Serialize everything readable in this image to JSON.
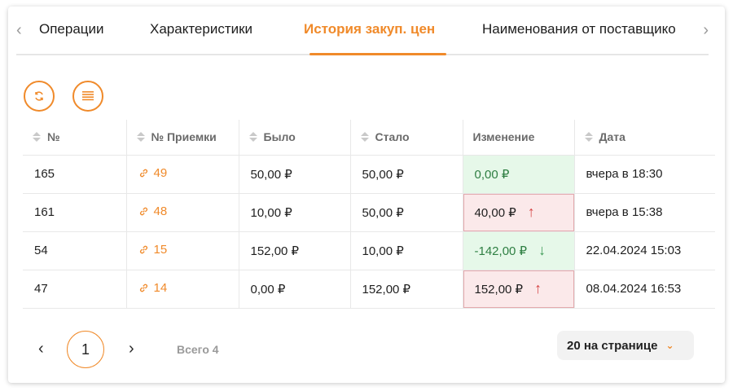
{
  "tabs": [
    {
      "label": "Операции"
    },
    {
      "label": "Характеристики"
    },
    {
      "label": "История закуп. цен"
    },
    {
      "label": "Наименования от поставщико"
    }
  ],
  "active_tab_index": 2,
  "accent_color": "#f08a2a",
  "toolbar": {
    "refresh_icon": "refresh-icon",
    "columns_icon": "list-icon"
  },
  "table": {
    "columns": [
      "№",
      "№ Приемки",
      "Было",
      "Стало",
      "Изменение",
      "Дата"
    ],
    "rows": [
      {
        "num": "165",
        "receipt": "49",
        "was": "50,00 ₽",
        "now": "50,00 ₽",
        "change": "0,00 ₽",
        "direction": "none",
        "date": "вчера в 18:30"
      },
      {
        "num": "161",
        "receipt": "48",
        "was": "10,00 ₽",
        "now": "50,00 ₽",
        "change": "40,00 ₽",
        "direction": "up",
        "date": "вчера в 15:38"
      },
      {
        "num": "54",
        "receipt": "15",
        "was": "152,00 ₽",
        "now": "10,00 ₽",
        "change": "-142,00 ₽",
        "direction": "down",
        "date": "22.04.2024 15:03"
      },
      {
        "num": "47",
        "receipt": "14",
        "was": "0,00 ₽",
        "now": "152,00 ₽",
        "change": "152,00 ₽",
        "direction": "up",
        "date": "08.04.2024 16:53"
      }
    ]
  },
  "pagination": {
    "current_page": "1",
    "total": "Всего 4",
    "page_size": "20 на странице"
  }
}
